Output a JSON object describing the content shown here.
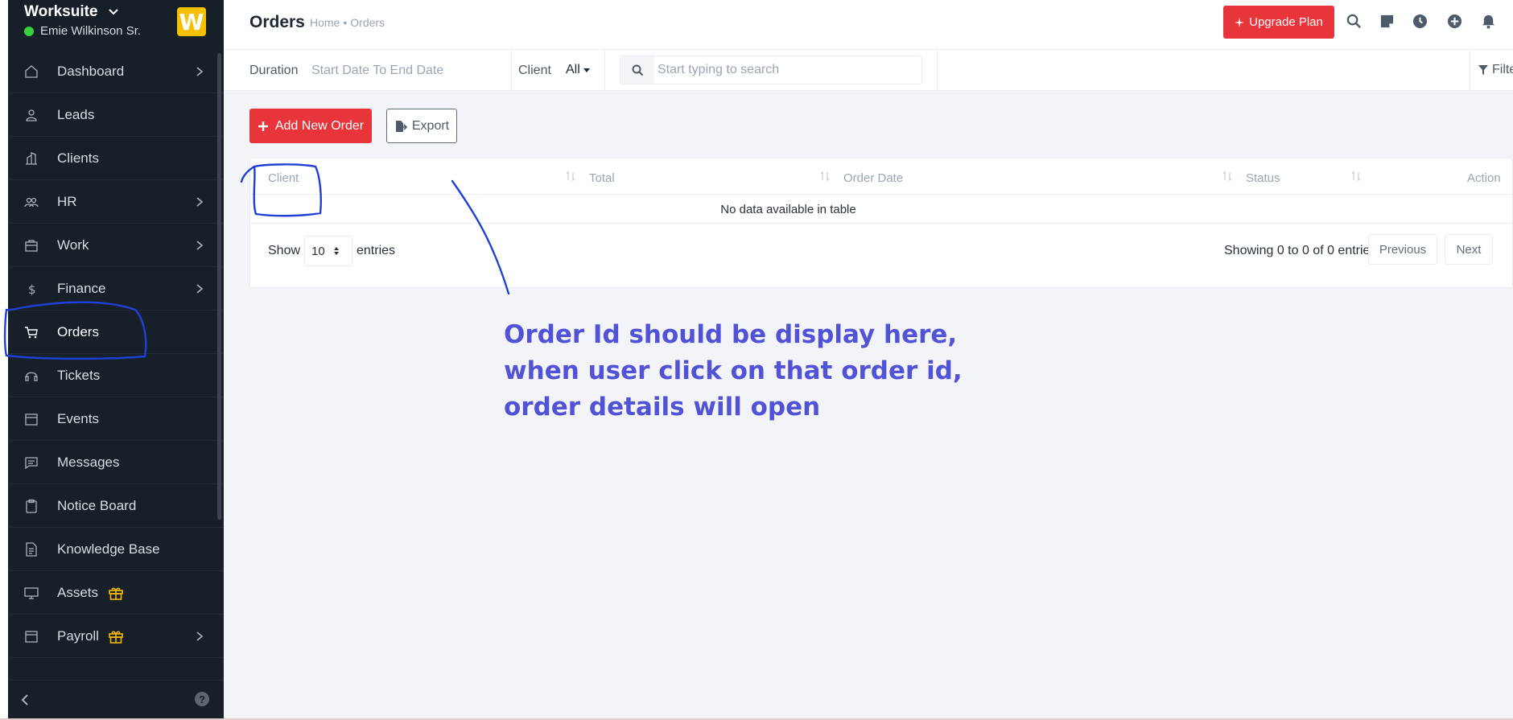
{
  "sidebar": {
    "brand": "Worksuite",
    "user": "Emie Wilkinson Sr.",
    "logo_letter": "W",
    "items": [
      {
        "label": "Dashboard",
        "icon": "home-icon",
        "chevron": true
      },
      {
        "label": "Leads",
        "icon": "user-icon",
        "chevron": false
      },
      {
        "label": "Clients",
        "icon": "building-icon",
        "chevron": false
      },
      {
        "label": "HR",
        "icon": "people-icon",
        "chevron": true
      },
      {
        "label": "Work",
        "icon": "briefcase-icon",
        "chevron": true
      },
      {
        "label": "Finance",
        "icon": "dollar-icon",
        "chevron": true
      },
      {
        "label": "Orders",
        "icon": "cart-icon",
        "chevron": false,
        "active": true
      },
      {
        "label": "Tickets",
        "icon": "headset-icon",
        "chevron": false
      },
      {
        "label": "Events",
        "icon": "calendar-icon",
        "chevron": false
      },
      {
        "label": "Messages",
        "icon": "chat-icon",
        "chevron": false
      },
      {
        "label": "Notice Board",
        "icon": "clipboard-icon",
        "chevron": false
      },
      {
        "label": "Knowledge Base",
        "icon": "document-icon",
        "chevron": false
      },
      {
        "label": "Assets",
        "icon": "monitor-icon",
        "chevron": false,
        "gift": true
      },
      {
        "label": "Payroll",
        "icon": "wallet-icon",
        "chevron": true,
        "gift": true
      }
    ]
  },
  "header": {
    "title": "Orders",
    "breadcrumb": [
      "Home",
      "•",
      "Orders"
    ],
    "upgrade_label": "Upgrade Plan"
  },
  "filters": {
    "duration_label": "Duration",
    "duration_value": "Start Date To End Date",
    "client_label": "Client",
    "client_value": "All",
    "search_placeholder": "Start typing to search",
    "filters_label": "Filte"
  },
  "actions": {
    "add_label": "Add New Order",
    "export_label": "Export"
  },
  "table": {
    "columns": [
      "Client",
      "Total",
      "Order Date",
      "Status",
      "Action"
    ],
    "empty_message": "No data available in table",
    "show_label": "Show",
    "entries_value": "10",
    "entries_label": "entries",
    "showing_text": "Showing 0 to 0 of 0 entries",
    "prev_label": "Previous",
    "next_label": "Next"
  },
  "annotation": {
    "lines": [
      "Order Id should be display here,",
      "when user click on that order id,",
      "order details will open"
    ],
    "color": "#5252d6"
  },
  "colors": {
    "sidebar_bg": "#171f29",
    "accent_red": "#e8353b",
    "brand_yellow": "#f5c000"
  }
}
